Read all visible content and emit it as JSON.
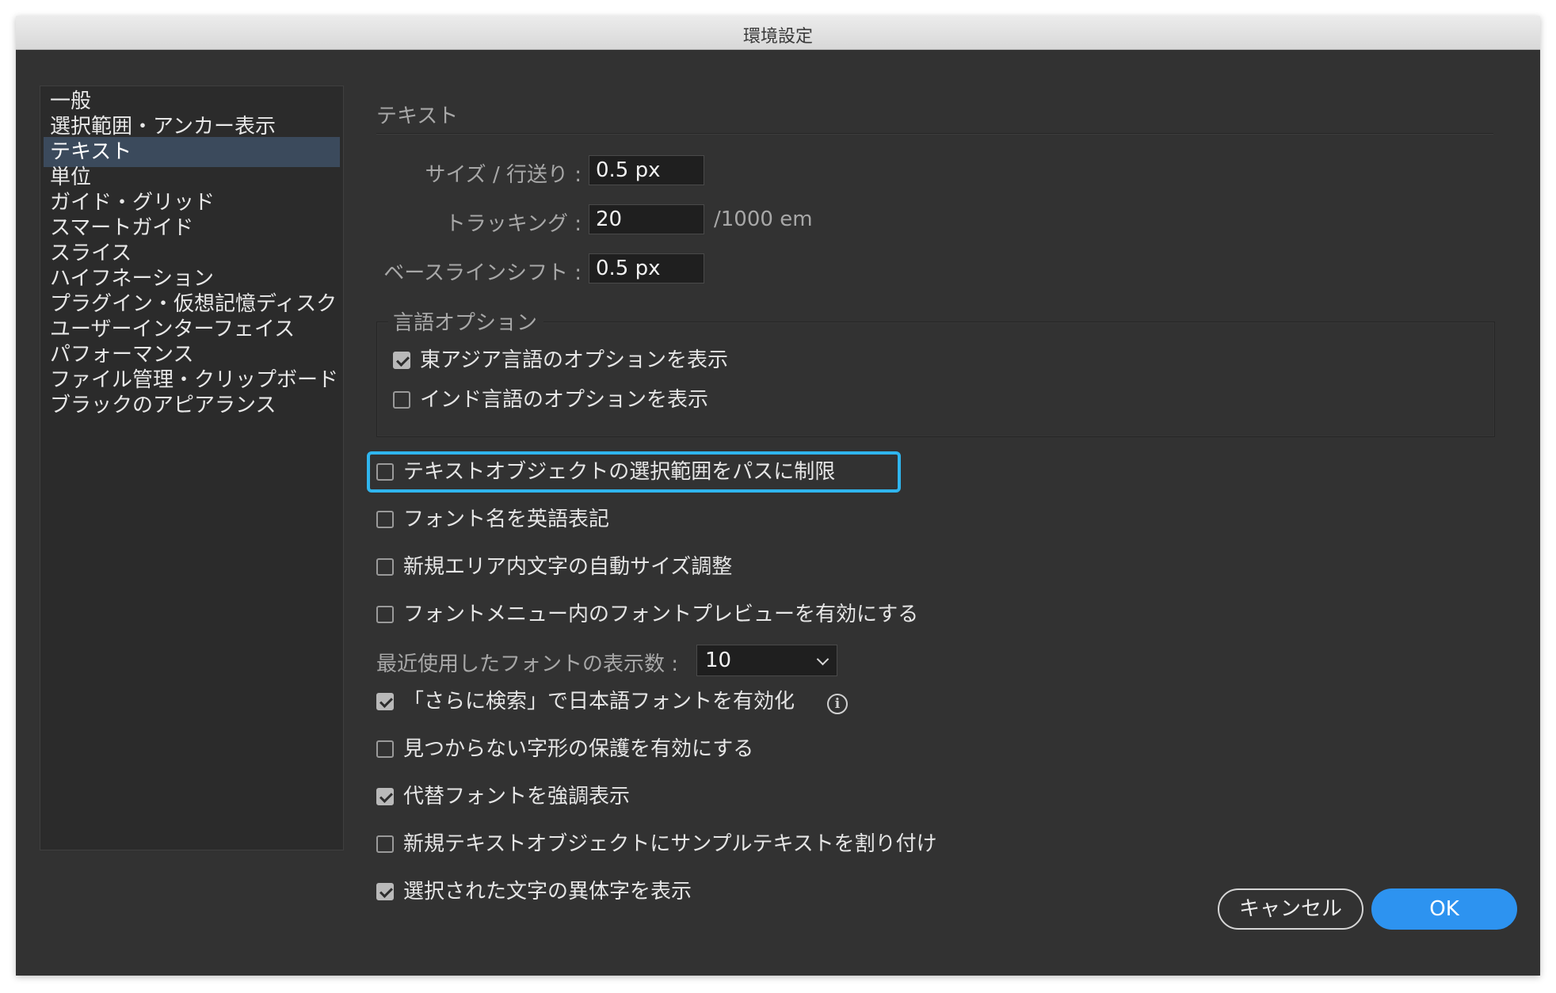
{
  "window": {
    "title": "環境設定"
  },
  "sidebar": {
    "items": [
      {
        "label": "一般"
      },
      {
        "label": "選択範囲・アンカー表示"
      },
      {
        "label": "テキスト",
        "selected": true
      },
      {
        "label": "単位"
      },
      {
        "label": "ガイド・グリッド"
      },
      {
        "label": "スマートガイド"
      },
      {
        "label": "スライス"
      },
      {
        "label": "ハイフネーション"
      },
      {
        "label": "プラグイン・仮想記憶ディスク"
      },
      {
        "label": "ユーザーインターフェイス"
      },
      {
        "label": "パフォーマンス"
      },
      {
        "label": "ファイル管理・クリップボード"
      },
      {
        "label": "ブラックのアピアランス"
      }
    ]
  },
  "text": {
    "section_title": "テキスト",
    "size_leading": {
      "label": "サイズ / 行送り :",
      "value": "0.5 px"
    },
    "tracking": {
      "label": "トラッキング :",
      "value": "20",
      "suffix": "/1000 em"
    },
    "baseline_shift": {
      "label": "ベースラインシフト :",
      "value": "0.5 px"
    },
    "language_options": {
      "title": "言語オプション",
      "east_asian": {
        "label": "東アジア言語のオプションを表示",
        "checked": true
      },
      "indic": {
        "label": "インド言語のオプションを表示",
        "checked": false
      }
    },
    "options": [
      {
        "label": "テキストオブジェクトの選択範囲をパスに制限",
        "checked": false
      },
      {
        "label": "フォント名を英語表記",
        "checked": false
      },
      {
        "label": "新規エリア内文字の自動サイズ調整",
        "checked": false
      },
      {
        "label": "フォントメニュー内のフォントプレビューを有効にする",
        "checked": false
      }
    ],
    "recent_fonts": {
      "label": "最近使用したフォントの表示数 :",
      "value": "10"
    },
    "options2": [
      {
        "label": "「さらに検索」で日本語フォントを有効化",
        "checked": true
      },
      {
        "label": "見つからない字形の保護を有効にする",
        "checked": false
      },
      {
        "label": "代替フォントを強調表示",
        "checked": true
      },
      {
        "label": "新規テキストオブジェクトにサンプルテキストを割り付け",
        "checked": false
      },
      {
        "label": "選択された文字の異体字を表示",
        "checked": true
      }
    ],
    "info_icon": "info-icon"
  },
  "buttons": {
    "cancel": "キャンセル",
    "ok": "OK"
  },
  "colors": {
    "highlight": "#2fb5ee",
    "ok_button": "#2d93f0",
    "selected_item": "#3b4a5c"
  }
}
